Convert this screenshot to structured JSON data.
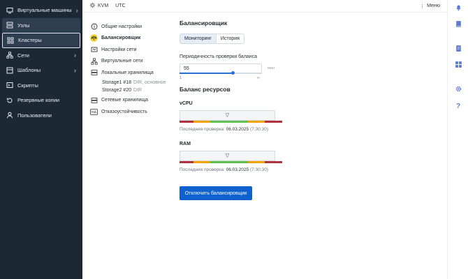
{
  "sidebar": {
    "items": [
      {
        "label": "Виртуальные машины",
        "icon": "vm-icon",
        "chevron": "›"
      },
      {
        "label": "Узлы",
        "icon": "nodes-icon",
        "chevron": ""
      },
      {
        "label": "Кластеры",
        "icon": "clusters-icon",
        "chevron": ""
      },
      {
        "label": "Сети",
        "icon": "network-icon",
        "chevron": "›"
      },
      {
        "label": "Шаблоны",
        "icon": "templates-icon",
        "chevron": "›"
      },
      {
        "label": "Скрипты",
        "icon": "scripts-icon",
        "chevron": ""
      },
      {
        "label": "Резервные копии",
        "icon": "backup-icon",
        "chevron": ""
      },
      {
        "label": "Пользователи",
        "icon": "users-icon",
        "chevron": ""
      }
    ]
  },
  "topbar": {
    "kvm": "KVM",
    "tz": "UTC",
    "menu": "Меню"
  },
  "settings": {
    "items": [
      {
        "label": "Общие настройки",
        "icon": "info-icon"
      },
      {
        "label": "Балансировщик",
        "icon": "balancer-icon"
      },
      {
        "label": "Настройки сети",
        "icon": "network-settings-icon"
      },
      {
        "label": "Виртуальные сети",
        "icon": "virtual-network-icon"
      },
      {
        "label": "Локальные хранилища",
        "icon": "local-storage-icon"
      }
    ],
    "storages": [
      {
        "name": "Storage1 #18",
        "meta": "DIR, основное"
      },
      {
        "name": "Storage2 #20",
        "meta": "DIR"
      }
    ],
    "extra": [
      {
        "label": "Сетевые хранилища",
        "icon": "network-storage-icon"
      },
      {
        "label": "Отказоустойчивость",
        "icon": "ha-icon"
      }
    ]
  },
  "main": {
    "title": "Балансировщик",
    "tabs": [
      "Мониторинг",
      "История"
    ],
    "interval_label": "Периодичность проверки баланса",
    "interval_value": "55",
    "interval_unit": "мин",
    "slider_min": "1",
    "slider_max": "∞",
    "slider_fraction": 0.65,
    "resources_title": "Баланс ресурсов",
    "cpu": {
      "label": "vCPU",
      "check_prefix": "Последняя проверка:",
      "date": "06.03.2025",
      "time": "(7:30:30)"
    },
    "ram": {
      "label": "RAM",
      "check_prefix": "Последняя проверка:",
      "date": "06.03.2025",
      "time": "(7:30:30)"
    },
    "button": "Отключить балансировщик"
  },
  "colors": {
    "accent": "#0f61d0",
    "sidebar_bg": "#1d2835",
    "red": "#b0323f",
    "orange": "#f2a400",
    "green": "#5fc14f"
  }
}
